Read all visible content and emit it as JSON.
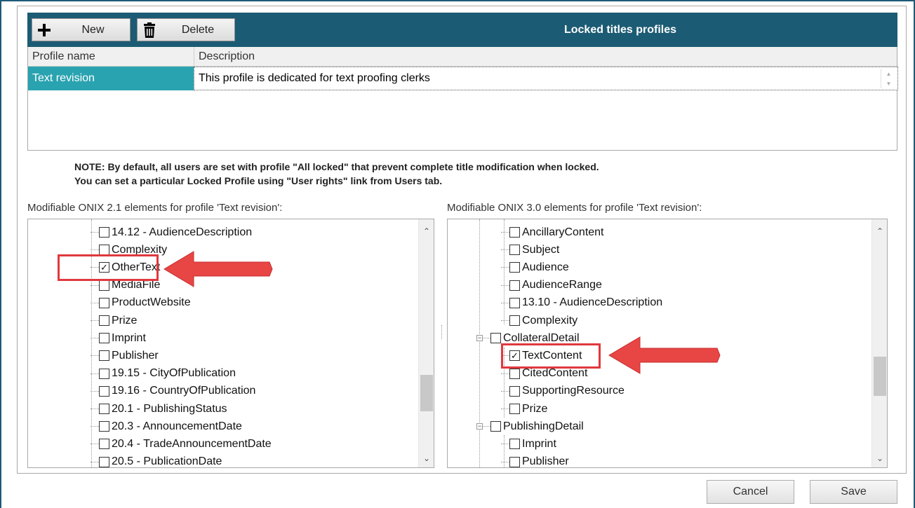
{
  "toolbar": {
    "new_label": "New",
    "delete_label": "Delete",
    "title": "Locked titles profiles",
    "icons": {
      "new": "plus-icon",
      "delete": "trash-icon"
    }
  },
  "grid": {
    "columns": [
      "Profile name",
      "Description"
    ],
    "rows": [
      {
        "name": "Text revision",
        "description": "This profile is dedicated for text proofing clerks"
      }
    ]
  },
  "note": {
    "line1": "NOTE: By default, all users are set with profile \"All locked\" that prevent complete title modification when locked.",
    "line2": "You can set a particular Locked Profile using \"User rights\" link from Users tab."
  },
  "onix21": {
    "label": "Modifiable ONIX 2.1 elements for profile 'Text revision':",
    "items": [
      {
        "label": "14.12 - AudienceDescription",
        "checked": false
      },
      {
        "label": "Complexity",
        "checked": false
      },
      {
        "label": "OtherText",
        "checked": true
      },
      {
        "label": "MediaFile",
        "checked": false
      },
      {
        "label": "ProductWebsite",
        "checked": false
      },
      {
        "label": "Prize",
        "checked": false
      },
      {
        "label": "Imprint",
        "checked": false
      },
      {
        "label": "Publisher",
        "checked": false
      },
      {
        "label": "19.15 - CityOfPublication",
        "checked": false
      },
      {
        "label": "19.16 - CountryOfPublication",
        "checked": false
      },
      {
        "label": "20.1 - PublishingStatus",
        "checked": false
      },
      {
        "label": "20.3 - AnnouncementDate",
        "checked": false
      },
      {
        "label": "20.4 - TradeAnnouncementDate",
        "checked": false
      },
      {
        "label": "20.5 - PublicationDate",
        "checked": false
      }
    ]
  },
  "onix30": {
    "label": "Modifiable ONIX 3.0 elements for profile 'Text revision':",
    "items": [
      {
        "label": "AncillaryContent",
        "checked": false,
        "level": 2
      },
      {
        "label": "Subject",
        "checked": false,
        "level": 2
      },
      {
        "label": "Audience",
        "checked": false,
        "level": 2
      },
      {
        "label": "AudienceRange",
        "checked": false,
        "level": 2
      },
      {
        "label": "13.10 - AudienceDescription",
        "checked": false,
        "level": 2
      },
      {
        "label": "Complexity",
        "checked": false,
        "level": 2
      },
      {
        "label": "CollateralDetail",
        "checked": false,
        "level": 1
      },
      {
        "label": "TextContent",
        "checked": true,
        "level": 2
      },
      {
        "label": "CitedContent",
        "checked": false,
        "level": 2
      },
      {
        "label": "SupportingResource",
        "checked": false,
        "level": 2
      },
      {
        "label": "Prize",
        "checked": false,
        "level": 2
      },
      {
        "label": "PublishingDetail",
        "checked": false,
        "level": 1
      },
      {
        "label": "Imprint",
        "checked": false,
        "level": 2
      },
      {
        "label": "Publisher",
        "checked": false,
        "level": 2
      }
    ]
  },
  "buttons": {
    "cancel": "Cancel",
    "save": "Save"
  },
  "colors": {
    "header": "#1c5b74",
    "selection": "#2aa3b0",
    "annotation": "#e0393e"
  }
}
